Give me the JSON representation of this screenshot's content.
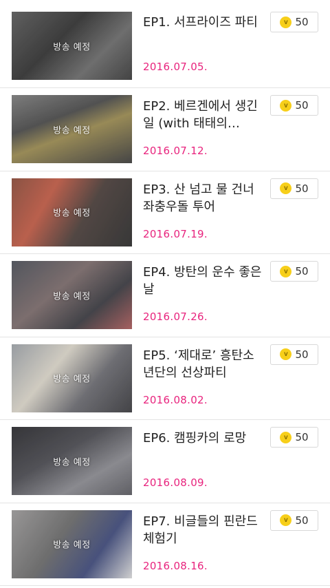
{
  "episodes": [
    {
      "title": "EP1. 서프라이즈 파티",
      "date": "2016.07.05.",
      "price": "50",
      "thumb_label": "방송 예정"
    },
    {
      "title": "EP2. 베르겐에서 생긴 일 (with 태태의…",
      "date": "2016.07.12.",
      "price": "50",
      "thumb_label": "방송 예정"
    },
    {
      "title": "EP3. 산 넘고 물 건너 좌충우돌 투어",
      "date": "2016.07.19.",
      "price": "50",
      "thumb_label": "방송 예정"
    },
    {
      "title": "EP4. 방탄의 운수 좋은 날",
      "date": "2016.07.26.",
      "price": "50",
      "thumb_label": "방송 예정"
    },
    {
      "title": "EP5. ‘제대로’ 흥탄소년단의 선상파티",
      "date": "2016.08.02.",
      "price": "50",
      "thumb_label": "방송 예정"
    },
    {
      "title": "EP6. 캠핑카의 로망",
      "date": "2016.08.09.",
      "price": "50",
      "thumb_label": "방송 예정"
    },
    {
      "title": "EP7. 비글들의 핀란드 체험기",
      "date": "2016.08.16.",
      "price": "50",
      "thumb_label": "방송 예정"
    }
  ],
  "coin_glyph": "v",
  "colors": {
    "date": "#e8237d",
    "coin": "#f7cf1a",
    "divider": "#e3e3e3"
  },
  "icons": {
    "coin": "coin-icon"
  }
}
